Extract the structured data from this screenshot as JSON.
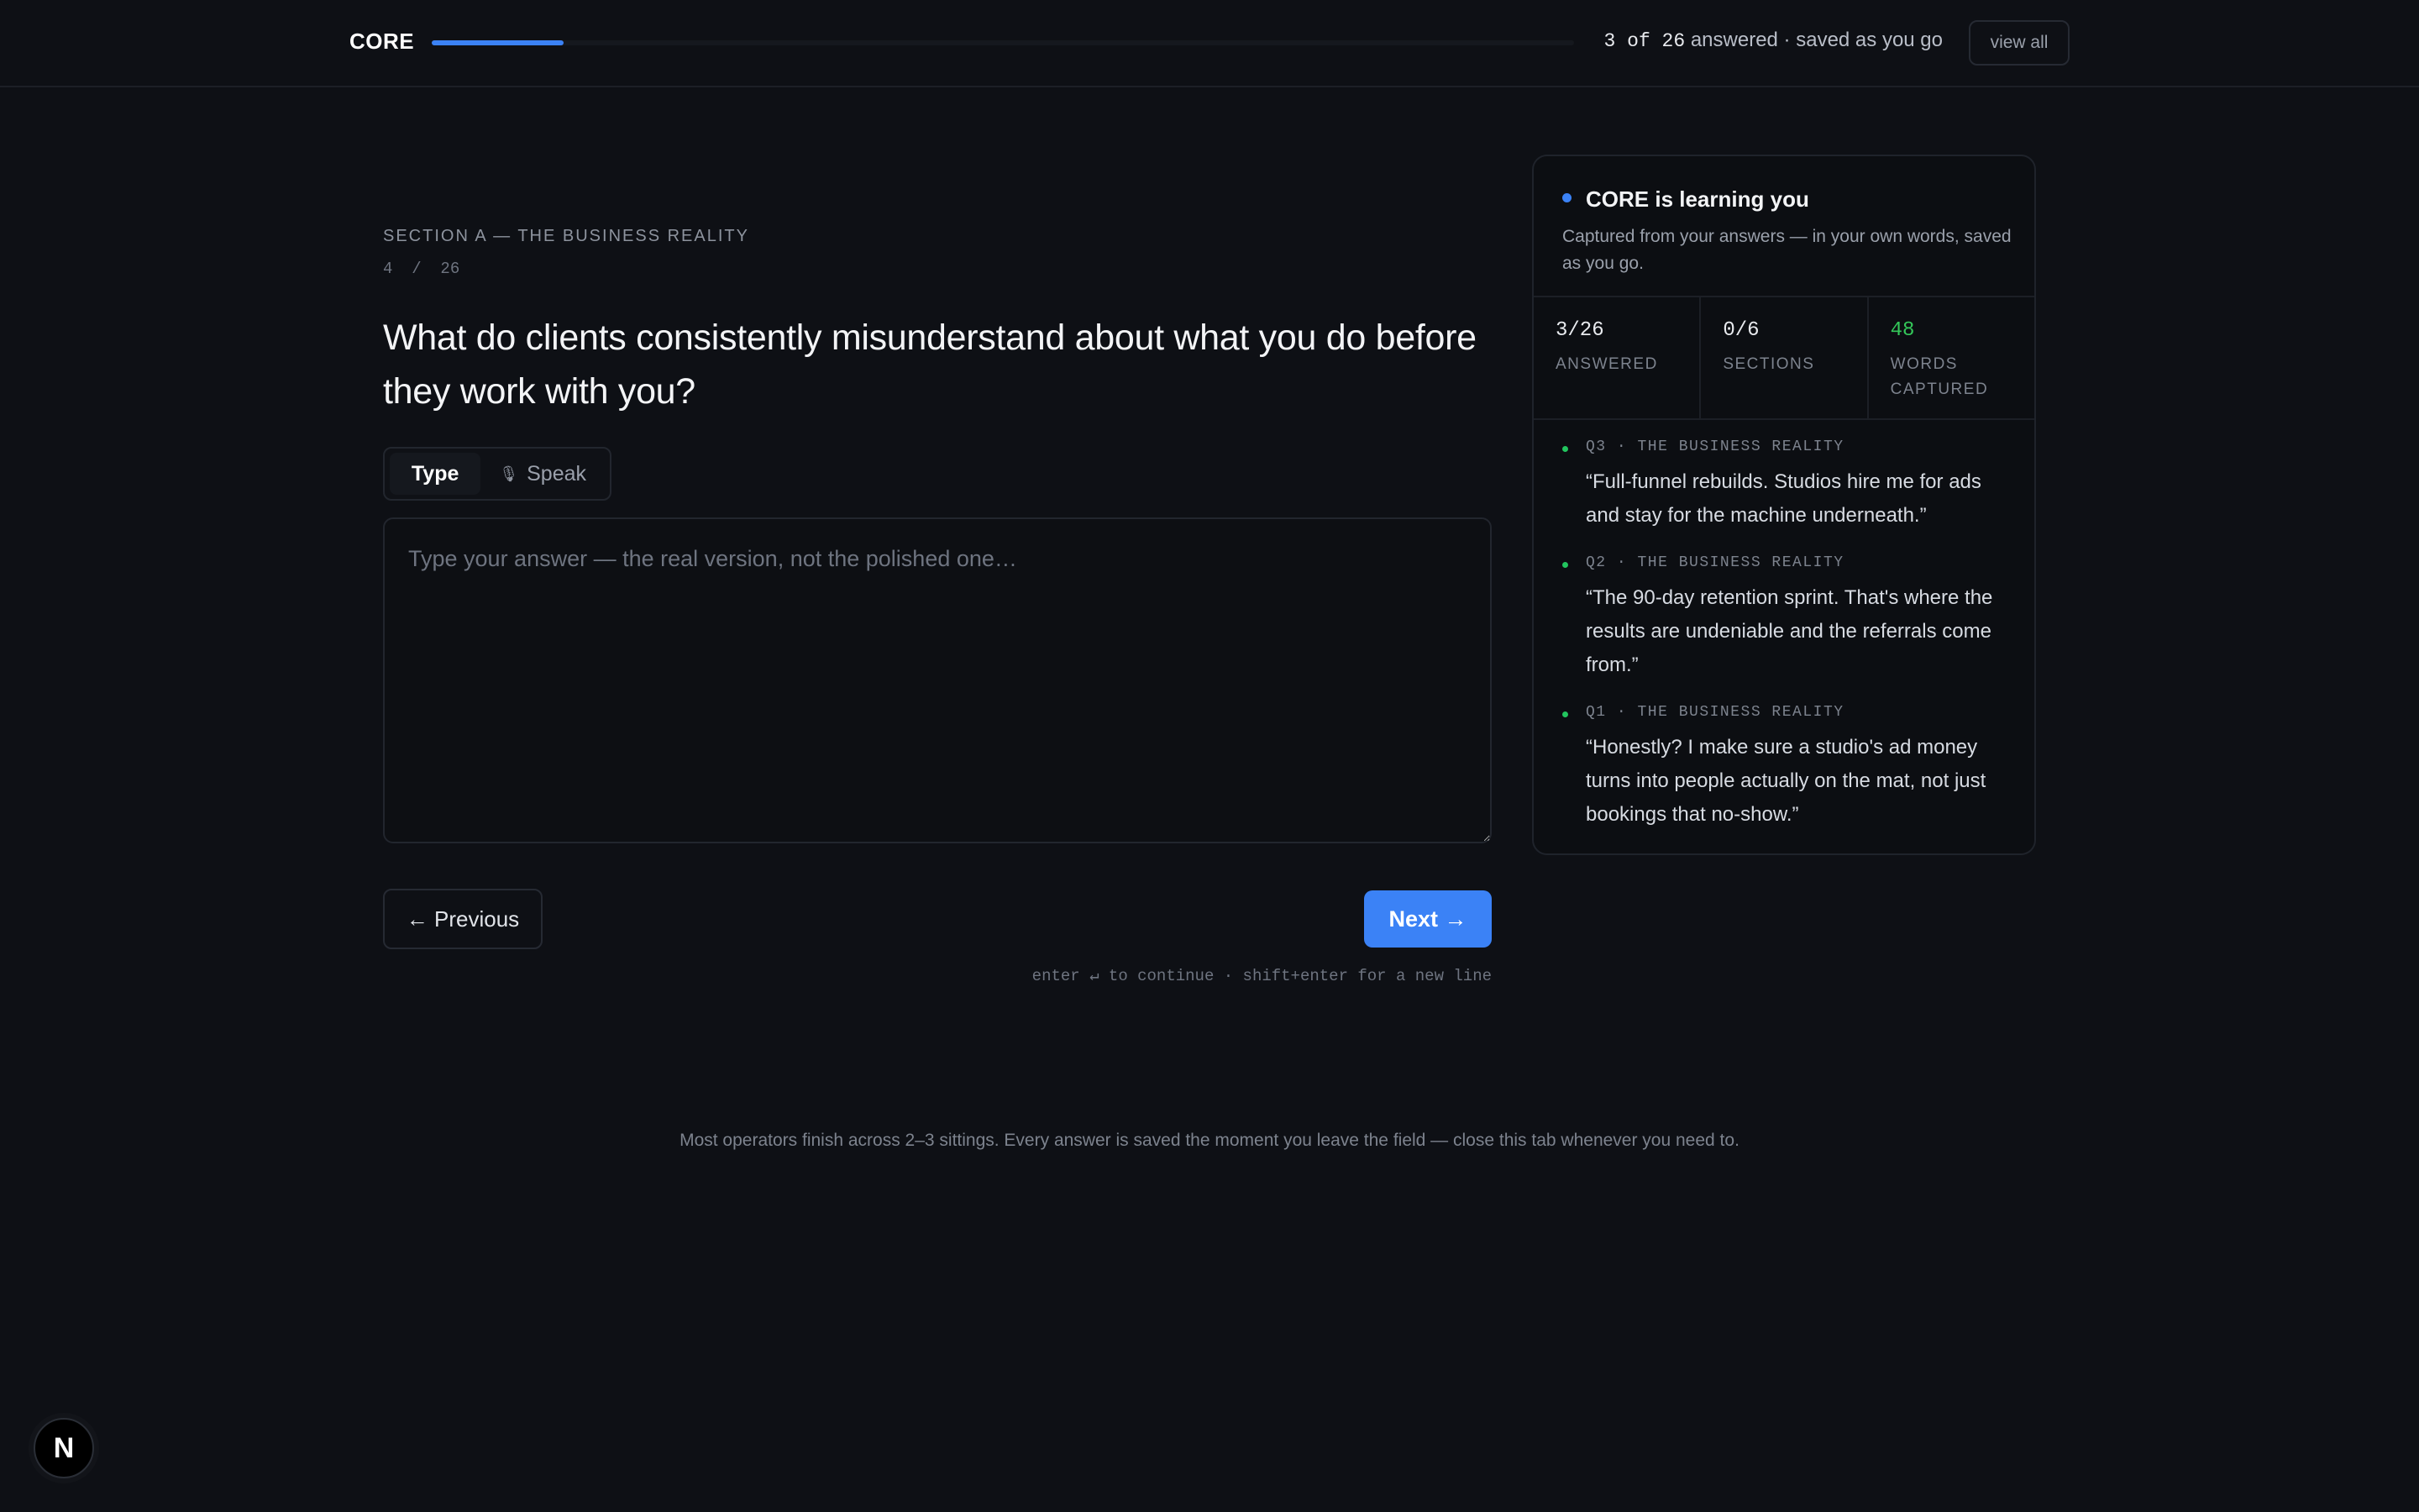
{
  "header": {
    "brand": "CORE",
    "progress_fraction": 0.1154,
    "answered_count": "3 of 26",
    "answered_text": " answered · saved as you go",
    "view_all_label": "view all"
  },
  "question": {
    "section_label": "SECTION A — THE BUSINESS REALITY",
    "counter": "4  /  26",
    "title": "What do clients consistently misunderstand about what you do before they work with you?",
    "mode_type_label": "Type",
    "mode_speak_label": "Speak",
    "mic_icon": "🎙",
    "answer_value": "",
    "answer_placeholder": "Type your answer — the real version, not the polished one…",
    "previous_label": "← Previous",
    "next_label": "Next →",
    "keyboard_hint": "enter ↵ to continue · shift+enter for a new line"
  },
  "panel": {
    "title": "CORE is learning you",
    "subtitle": "Captured from your answers — in your own words, saved as you go.",
    "stats": [
      {
        "value": "3/26",
        "label": "ANSWERED"
      },
      {
        "value": "0/6",
        "label": "SECTIONS"
      },
      {
        "value": "48",
        "label": "WORDS CAPTURED"
      }
    ],
    "items": [
      {
        "meta": "Q3 · THE BUSINESS REALITY",
        "quote": "“Full-funnel rebuilds. Studios hire me for ads and stay for the machine underneath.”"
      },
      {
        "meta": "Q2 · THE BUSINESS REALITY",
        "quote": "“The 90-day retention sprint. That's where the results are undeniable and the referrals come from.”"
      },
      {
        "meta": "Q1 · THE BUSINESS REALITY",
        "quote": "“Honestly? I make sure a studio's ad money turns into people actually on the mat, not just bookings that no-show.”"
      }
    ]
  },
  "footer": {
    "note": "Most operators finish across 2–3 sittings. Every answer is saved the moment you leave the field — close this tab whenever you need to.",
    "badge_letter": "N"
  },
  "colors": {
    "accent": "#3b82f6",
    "success": "#22c55e",
    "background": "#0e1015"
  }
}
